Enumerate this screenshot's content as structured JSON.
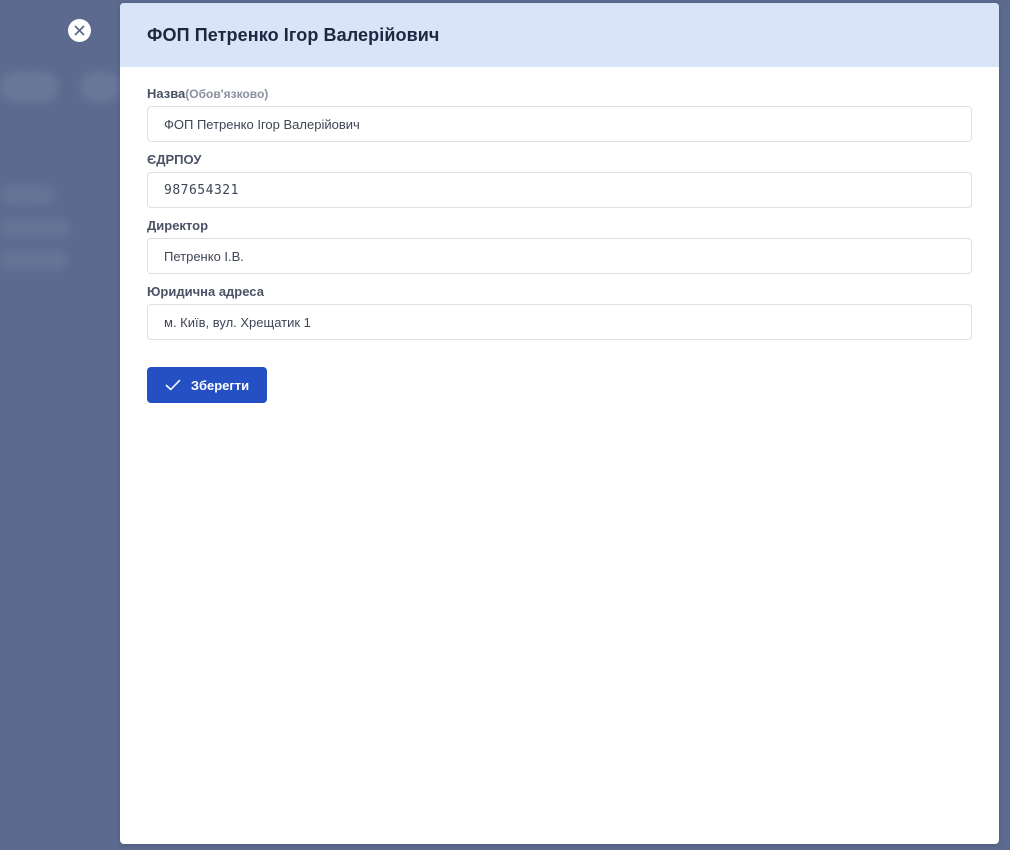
{
  "modal": {
    "title": "ФОП Петренко Ігор Валерійович",
    "close_icon": "close-icon"
  },
  "form": {
    "fields": [
      {
        "label": "Назва",
        "hint": "(Обов'язково)",
        "value": "ФОП Петренко Ігор Валерійович"
      },
      {
        "label": "ЄДРПОУ",
        "value": "987654321"
      },
      {
        "label": "Директор",
        "value": "Петренко І.В."
      },
      {
        "label": "Юридична адреса",
        "value": "м. Київ, вул. Хрещатик 1"
      }
    ],
    "save_label": "Зберегти",
    "save_icon": "check-icon"
  },
  "colors": {
    "overlay": "#5b6a8e",
    "header_bg": "#d9e4f8",
    "primary": "#2450c4"
  }
}
